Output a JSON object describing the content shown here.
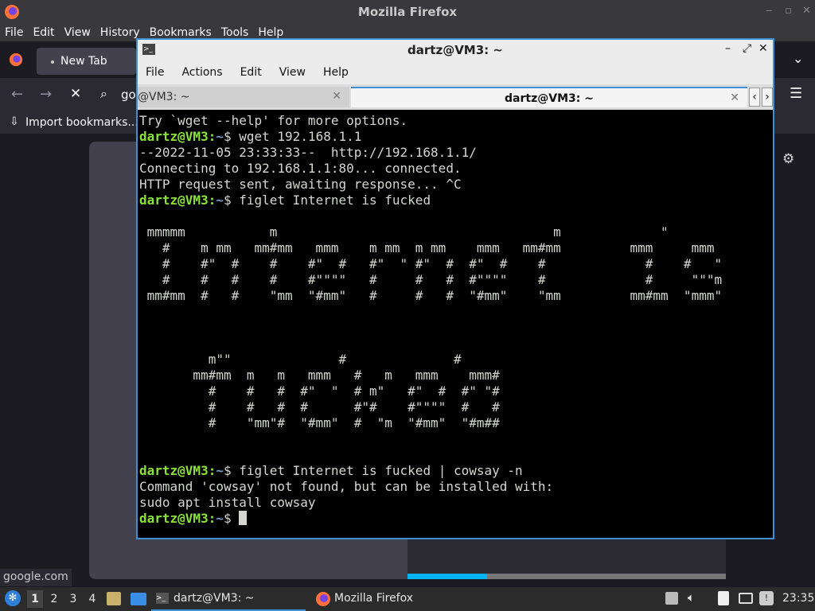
{
  "firefox": {
    "title": "Mozilla Firefox",
    "menu": [
      "File",
      "Edit",
      "View",
      "History",
      "Bookmarks",
      "Tools",
      "Help"
    ],
    "tab_label": "New Tab",
    "url_partial": "go",
    "bookmark_label": "Import bookmarks...",
    "status_text": "google.com",
    "loading_progress_fraction": 0.25
  },
  "terminal": {
    "title": "dartz@VM3: ~",
    "menu": [
      "File",
      "Actions",
      "Edit",
      "View",
      "Help"
    ],
    "tabs": [
      {
        "label": "@VM3: ~",
        "active": false
      },
      {
        "label": "dartz@VM3: ~",
        "active": true
      }
    ],
    "prompt_user": "dartz@VM3",
    "prompt_path": "~",
    "lines": [
      {
        "type": "out",
        "text": "Try `wget --help' for more options."
      },
      {
        "type": "prompt",
        "cmd": " wget 192.168.1.1"
      },
      {
        "type": "out",
        "text": "--2022-11-05 23:33:33--  http://192.168.1.1/"
      },
      {
        "type": "out",
        "text": "Connecting to 192.168.1.1:80... connected."
      },
      {
        "type": "out",
        "text": "HTTP request sent, awaiting response... ^C"
      },
      {
        "type": "prompt",
        "cmd": " figlet Internet is fucked"
      },
      {
        "type": "out",
        "text": ""
      },
      {
        "type": "out",
        "text": " mmmmm           m                                    m             \""
      },
      {
        "type": "out",
        "text": "   #    m mm   mm#mm   mmm    m mm  m mm    mmm   mm#mm         mmm     mmm"
      },
      {
        "type": "out",
        "text": "   #    #\"  #    #    #\"  #   #\"  \" #\"  #  #\"  #    #             #    #   \""
      },
      {
        "type": "out",
        "text": "   #    #   #    #    #\"\"\"\"   #     #   #  #\"\"\"\"    #             #     \"\"\"m"
      },
      {
        "type": "out",
        "text": " mm#mm  #   #    \"mm  \"#mm\"   #     #   #  \"#mm\"    \"mm         mm#mm  \"mmm\""
      },
      {
        "type": "out",
        "text": ""
      },
      {
        "type": "out",
        "text": ""
      },
      {
        "type": "out",
        "text": ""
      },
      {
        "type": "out",
        "text": "         m\"\"              #              #"
      },
      {
        "type": "out",
        "text": "       mm#mm  m   m   mmm   #   m   mmm    mmm#"
      },
      {
        "type": "out",
        "text": "         #    #   #  #\"  \"  # m\"   #\"  #  #\" \"#"
      },
      {
        "type": "out",
        "text": "         #    #   #  #      #\"#    #\"\"\"\"  #   #"
      },
      {
        "type": "out",
        "text": "         #    \"mm\"#  \"#mm\"  #  \"m  \"#mm\"  \"#m##"
      },
      {
        "type": "out",
        "text": ""
      },
      {
        "type": "out",
        "text": ""
      },
      {
        "type": "prompt",
        "cmd": " figlet Internet is fucked | cowsay -n"
      },
      {
        "type": "out",
        "text": "Command 'cowsay' not found, but can be installed with:"
      },
      {
        "type": "out",
        "text": "sudo apt install cowsay"
      },
      {
        "type": "prompt-cursor",
        "cmd": " "
      }
    ]
  },
  "taskbar": {
    "workspaces": [
      "1",
      "2",
      "3",
      "4"
    ],
    "active_workspace": "1",
    "tasks": [
      "dartz@VM3: ~",
      "Mozilla Firefox"
    ],
    "clock": "23:35"
  },
  "colors": {
    "accent": "#3d8fd6",
    "prompt_user": "#8ae234",
    "prompt_path": "#729fcf",
    "progress": "#00b3f4"
  }
}
